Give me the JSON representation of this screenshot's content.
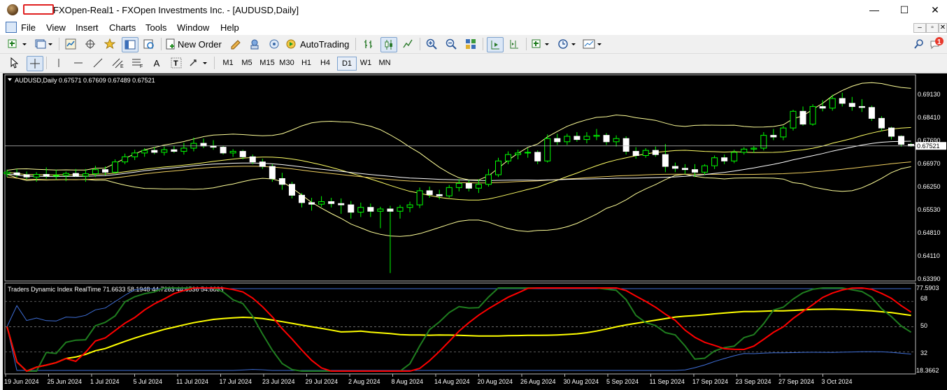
{
  "window": {
    "title": "FXOpen-Real1 - FXOpen Investments Inc. - [AUDUSD,Daily]",
    "controls": {
      "minimize": "—",
      "maximize": "☐",
      "close": "✕"
    }
  },
  "menu": [
    "File",
    "View",
    "Insert",
    "Charts",
    "Tools",
    "Window",
    "Help"
  ],
  "mdi_controls": [
    "‒",
    "▫",
    "✕"
  ],
  "toolbar": {
    "new_order": "New Order",
    "auto_trading": "AutoTrading",
    "notification_count": "1"
  },
  "timeframes": [
    {
      "label": "M1",
      "selected": false
    },
    {
      "label": "M5",
      "selected": false
    },
    {
      "label": "M15",
      "selected": false
    },
    {
      "label": "M30",
      "selected": false
    },
    {
      "label": "H1",
      "selected": false
    },
    {
      "label": "H4",
      "selected": false
    },
    {
      "label": "D1",
      "selected": true
    },
    {
      "label": "W1",
      "selected": false
    },
    {
      "label": "MN",
      "selected": false
    }
  ],
  "drawing_tools": {
    "text": "A",
    "textlabel": "T"
  },
  "chart": {
    "header": "AUDUSD,Daily  0.67571 0.67609 0.67489 0.67521",
    "current_price": "0.67521",
    "price_axis": [
      "0.69130",
      "0.68410",
      "0.67690",
      "0.66970",
      "0.66250",
      "0.65530",
      "0.64810",
      "0.64110",
      "0.63390"
    ],
    "indicator_header": "Traders Dynamic Index RealTime 71.6633 58.1948 44.7263 44.6536 54.8883",
    "indicator_axis": [
      "77.5903",
      "68",
      "50",
      "32",
      "18.3662"
    ],
    "date_axis": [
      "19 Jun 2024",
      "25 Jun 2024",
      "1 Jul 2024",
      "5 Jul 2024",
      "11 Jul 2024",
      "17 Jul 2024",
      "23 Jul 2024",
      "29 Jul 2024",
      "2 Aug 2024",
      "8 Aug 2024",
      "14 Aug 2024",
      "20 Aug 2024",
      "26 Aug 2024",
      "30 Aug 2024",
      "5 Sep 2024",
      "11 Sep 2024",
      "17 Sep 2024",
      "23 Sep 2024",
      "27 Sep 2024",
      "3 Oct 2024"
    ],
    "colors": {
      "background": "#000000",
      "bull": "#ffffff",
      "bear": "#ffffff",
      "wick": "#00ff00",
      "bands": "#ffff99",
      "price_line": "#ffffff",
      "green": "#1f7d1f",
      "red": "#ff0000",
      "yellow": "#ffff00",
      "blue": "#3f6fd8"
    }
  },
  "chart_data": {
    "type": "candlestick",
    "symbol": "AUDUSD",
    "timeframe": "Daily",
    "ylim": [
      0.6339,
      0.6949
    ],
    "candles": [
      {
        "o": 0.6665,
        "h": 0.6678,
        "l": 0.6655,
        "c": 0.667
      },
      {
        "o": 0.6668,
        "h": 0.668,
        "l": 0.6655,
        "c": 0.6662
      },
      {
        "o": 0.6662,
        "h": 0.6672,
        "l": 0.6648,
        "c": 0.6655
      },
      {
        "o": 0.6655,
        "h": 0.667,
        "l": 0.664,
        "c": 0.6663
      },
      {
        "o": 0.6663,
        "h": 0.6685,
        "l": 0.665,
        "c": 0.6658
      },
      {
        "o": 0.6658,
        "h": 0.6678,
        "l": 0.6646,
        "c": 0.666
      },
      {
        "o": 0.666,
        "h": 0.6672,
        "l": 0.6642,
        "c": 0.6666
      },
      {
        "o": 0.6666,
        "h": 0.668,
        "l": 0.6655,
        "c": 0.6658
      },
      {
        "o": 0.6658,
        "h": 0.668,
        "l": 0.664,
        "c": 0.6665
      },
      {
        "o": 0.6665,
        "h": 0.669,
        "l": 0.6655,
        "c": 0.6678
      },
      {
        "o": 0.6678,
        "h": 0.6688,
        "l": 0.666,
        "c": 0.667
      },
      {
        "o": 0.667,
        "h": 0.671,
        "l": 0.6665,
        "c": 0.6702
      },
      {
        "o": 0.6702,
        "h": 0.6728,
        "l": 0.6695,
        "c": 0.6718
      },
      {
        "o": 0.6718,
        "h": 0.674,
        "l": 0.6708,
        "c": 0.673
      },
      {
        "o": 0.673,
        "h": 0.6745,
        "l": 0.6718,
        "c": 0.6738
      },
      {
        "o": 0.6738,
        "h": 0.6748,
        "l": 0.6726,
        "c": 0.6732
      },
      {
        "o": 0.6732,
        "h": 0.675,
        "l": 0.6722,
        "c": 0.674
      },
      {
        "o": 0.674,
        "h": 0.6752,
        "l": 0.673,
        "c": 0.6735
      },
      {
        "o": 0.6735,
        "h": 0.6762,
        "l": 0.6725,
        "c": 0.6745
      },
      {
        "o": 0.6745,
        "h": 0.6778,
        "l": 0.6735,
        "c": 0.676
      },
      {
        "o": 0.676,
        "h": 0.6775,
        "l": 0.6745,
        "c": 0.6752
      },
      {
        "o": 0.6752,
        "h": 0.677,
        "l": 0.674,
        "c": 0.6748
      },
      {
        "o": 0.6748,
        "h": 0.6752,
        "l": 0.6725,
        "c": 0.673
      },
      {
        "o": 0.673,
        "h": 0.6742,
        "l": 0.6718,
        "c": 0.6735
      },
      {
        "o": 0.6735,
        "h": 0.674,
        "l": 0.671,
        "c": 0.6718
      },
      {
        "o": 0.6718,
        "h": 0.6725,
        "l": 0.6695,
        "c": 0.6702
      },
      {
        "o": 0.6702,
        "h": 0.6712,
        "l": 0.668,
        "c": 0.6688
      },
      {
        "o": 0.6688,
        "h": 0.6695,
        "l": 0.664,
        "c": 0.665
      },
      {
        "o": 0.665,
        "h": 0.6668,
        "l": 0.6615,
        "c": 0.6632
      },
      {
        "o": 0.6632,
        "h": 0.664,
        "l": 0.6588,
        "c": 0.6598
      },
      {
        "o": 0.6598,
        "h": 0.6605,
        "l": 0.656,
        "c": 0.6575
      },
      {
        "o": 0.6575,
        "h": 0.659,
        "l": 0.655,
        "c": 0.657
      },
      {
        "o": 0.657,
        "h": 0.6595,
        "l": 0.6562,
        "c": 0.6578
      },
      {
        "o": 0.6578,
        "h": 0.659,
        "l": 0.656,
        "c": 0.6572
      },
      {
        "o": 0.6572,
        "h": 0.6588,
        "l": 0.654,
        "c": 0.6568
      },
      {
        "o": 0.6568,
        "h": 0.658,
        "l": 0.6525,
        "c": 0.6545
      },
      {
        "o": 0.6545,
        "h": 0.6575,
        "l": 0.653,
        "c": 0.656
      },
      {
        "o": 0.656,
        "h": 0.6572,
        "l": 0.653,
        "c": 0.6548
      },
      {
        "o": 0.6548,
        "h": 0.6562,
        "l": 0.6495,
        "c": 0.6555
      },
      {
        "o": 0.6555,
        "h": 0.6565,
        "l": 0.6355,
        "c": 0.6548
      },
      {
        "o": 0.6548,
        "h": 0.6568,
        "l": 0.6525,
        "c": 0.656
      },
      {
        "o": 0.656,
        "h": 0.6578,
        "l": 0.6545,
        "c": 0.6568
      },
      {
        "o": 0.6568,
        "h": 0.6622,
        "l": 0.6558,
        "c": 0.6612
      },
      {
        "o": 0.6612,
        "h": 0.6625,
        "l": 0.659,
        "c": 0.66
      },
      {
        "o": 0.66,
        "h": 0.6615,
        "l": 0.6585,
        "c": 0.6596
      },
      {
        "o": 0.6596,
        "h": 0.663,
        "l": 0.659,
        "c": 0.6622
      },
      {
        "o": 0.6622,
        "h": 0.6648,
        "l": 0.661,
        "c": 0.6635
      },
      {
        "o": 0.6635,
        "h": 0.6645,
        "l": 0.661,
        "c": 0.662
      },
      {
        "o": 0.662,
        "h": 0.6648,
        "l": 0.6605,
        "c": 0.6632
      },
      {
        "o": 0.6632,
        "h": 0.668,
        "l": 0.6625,
        "c": 0.6662
      },
      {
        "o": 0.6662,
        "h": 0.6715,
        "l": 0.6655,
        "c": 0.6705
      },
      {
        "o": 0.6705,
        "h": 0.6735,
        "l": 0.6695,
        "c": 0.6725
      },
      {
        "o": 0.6725,
        "h": 0.674,
        "l": 0.671,
        "c": 0.673
      },
      {
        "o": 0.673,
        "h": 0.6745,
        "l": 0.6715,
        "c": 0.6732
      },
      {
        "o": 0.6732,
        "h": 0.6738,
        "l": 0.6695,
        "c": 0.6705
      },
      {
        "o": 0.6705,
        "h": 0.6788,
        "l": 0.67,
        "c": 0.6775
      },
      {
        "o": 0.6775,
        "h": 0.679,
        "l": 0.6755,
        "c": 0.6765
      },
      {
        "o": 0.6765,
        "h": 0.679,
        "l": 0.6755,
        "c": 0.6782
      },
      {
        "o": 0.6782,
        "h": 0.6795,
        "l": 0.6765,
        "c": 0.6772
      },
      {
        "o": 0.6772,
        "h": 0.6795,
        "l": 0.676,
        "c": 0.6782
      },
      {
        "o": 0.6782,
        "h": 0.6805,
        "l": 0.677,
        "c": 0.6785
      },
      {
        "o": 0.6785,
        "h": 0.6792,
        "l": 0.6755,
        "c": 0.6765
      },
      {
        "o": 0.6765,
        "h": 0.6785,
        "l": 0.675,
        "c": 0.6775
      },
      {
        "o": 0.6775,
        "h": 0.6782,
        "l": 0.6725,
        "c": 0.6735
      },
      {
        "o": 0.6735,
        "h": 0.6748,
        "l": 0.6712,
        "c": 0.6722
      },
      {
        "o": 0.6722,
        "h": 0.6745,
        "l": 0.6715,
        "c": 0.6738
      },
      {
        "o": 0.6738,
        "h": 0.675,
        "l": 0.6718,
        "c": 0.6725
      },
      {
        "o": 0.6725,
        "h": 0.6758,
        "l": 0.667,
        "c": 0.6688
      },
      {
        "o": 0.6688,
        "h": 0.67,
        "l": 0.667,
        "c": 0.6682
      },
      {
        "o": 0.6682,
        "h": 0.6695,
        "l": 0.6665,
        "c": 0.6678
      },
      {
        "o": 0.6678,
        "h": 0.6695,
        "l": 0.6655,
        "c": 0.667
      },
      {
        "o": 0.667,
        "h": 0.6695,
        "l": 0.6662,
        "c": 0.669
      },
      {
        "o": 0.669,
        "h": 0.6722,
        "l": 0.668,
        "c": 0.6715
      },
      {
        "o": 0.6715,
        "h": 0.6725,
        "l": 0.6695,
        "c": 0.6705
      },
      {
        "o": 0.6705,
        "h": 0.674,
        "l": 0.6698,
        "c": 0.6732
      },
      {
        "o": 0.6732,
        "h": 0.6748,
        "l": 0.6725,
        "c": 0.6742
      },
      {
        "o": 0.6742,
        "h": 0.6752,
        "l": 0.673,
        "c": 0.6745
      },
      {
        "o": 0.6745,
        "h": 0.6795,
        "l": 0.6738,
        "c": 0.6785
      },
      {
        "o": 0.6785,
        "h": 0.6805,
        "l": 0.677,
        "c": 0.678
      },
      {
        "o": 0.678,
        "h": 0.6815,
        "l": 0.677,
        "c": 0.6808
      },
      {
        "o": 0.6808,
        "h": 0.6865,
        "l": 0.68,
        "c": 0.686
      },
      {
        "o": 0.686,
        "h": 0.6875,
        "l": 0.6815,
        "c": 0.682
      },
      {
        "o": 0.682,
        "h": 0.6882,
        "l": 0.6815,
        "c": 0.6875
      },
      {
        "o": 0.6875,
        "h": 0.6895,
        "l": 0.686,
        "c": 0.687
      },
      {
        "o": 0.687,
        "h": 0.6912,
        "l": 0.6862,
        "c": 0.69
      },
      {
        "o": 0.69,
        "h": 0.6918,
        "l": 0.6875,
        "c": 0.6885
      },
      {
        "o": 0.6885,
        "h": 0.6905,
        "l": 0.6862,
        "c": 0.6875
      },
      {
        "o": 0.6875,
        "h": 0.6898,
        "l": 0.6858,
        "c": 0.6872
      },
      {
        "o": 0.6872,
        "h": 0.6878,
        "l": 0.683,
        "c": 0.6838
      },
      {
        "o": 0.6838,
        "h": 0.6845,
        "l": 0.6798,
        "c": 0.6808
      },
      {
        "o": 0.6808,
        "h": 0.6812,
        "l": 0.6772,
        "c": 0.6782
      },
      {
        "o": 0.6782,
        "h": 0.6785,
        "l": 0.675,
        "c": 0.6757
      },
      {
        "o": 0.6757,
        "h": 0.6761,
        "l": 0.6749,
        "c": 0.6752
      }
    ],
    "indicator": {
      "name": "Traders Dynamic Index RealTime",
      "values": [
        71.6633,
        58.1948,
        44.7263,
        44.6536,
        54.8883
      ],
      "ylim": [
        18.3662,
        77.5903
      ],
      "levels": [
        68,
        50,
        32
      ],
      "series": [
        "green",
        "red",
        "yellow",
        "blue"
      ]
    }
  }
}
